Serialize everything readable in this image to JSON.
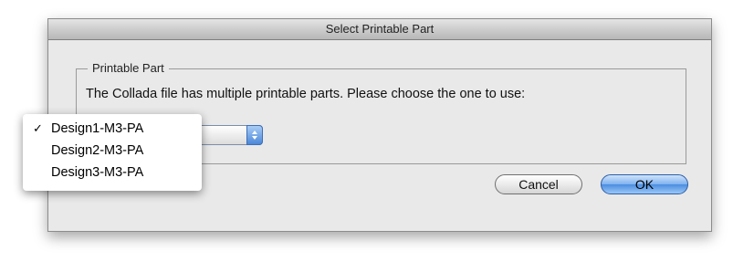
{
  "dialog": {
    "title": "Select Printable Part",
    "group_label": "Printable Part",
    "message": "The Collada file has multiple printable parts. Please choose the one to use:",
    "popup_menu": {
      "options": [
        {
          "label": "Design1-M3-PA",
          "checked": "✓"
        },
        {
          "label": "Design2-M3-PA",
          "checked": ""
        },
        {
          "label": "Design3-M3-PA",
          "checked": ""
        }
      ],
      "selected": "Design1-M3-PA"
    },
    "buttons": {
      "cancel": "Cancel",
      "ok": "OK"
    }
  }
}
